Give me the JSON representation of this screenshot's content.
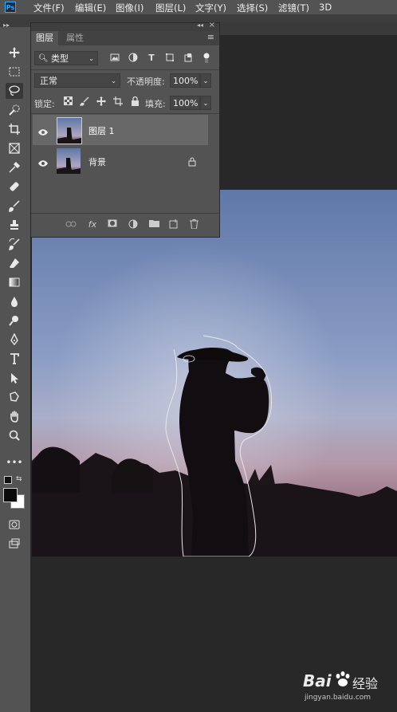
{
  "menubar": {
    "items": [
      "文件(F)",
      "编辑(E)",
      "图像(I)",
      "图层(L)",
      "文字(Y)",
      "选择(S)",
      "滤镜(T)",
      "3D"
    ]
  },
  "app": {
    "logo": "Ps"
  },
  "toolbar": {
    "collapse": "▸▸",
    "tools": [
      "move-tool",
      "marquee-tool",
      "lasso-tool",
      "quick-select-tool",
      "crop-tool",
      "frame-tool",
      "eyedropper-tool",
      "healing-tool",
      "brush-tool",
      "stamp-tool",
      "history-brush-tool",
      "eraser-tool",
      "gradient-tool",
      "blur-tool",
      "dodge-tool",
      "pen-tool",
      "type-tool",
      "path-select-tool",
      "shape-tool",
      "hand-tool",
      "zoom-tool",
      "more-tools"
    ]
  },
  "layers_panel": {
    "collapse": "◂◂",
    "close": "×",
    "menu": "≡",
    "tabs": [
      "图层",
      "属性"
    ],
    "filter_kind": "类型",
    "blend_mode": "正常",
    "opacity_label": "不透明度:",
    "opacity_value": "100%",
    "lock_label": "锁定:",
    "fill_label": "填充:",
    "fill_value": "100%",
    "layers": [
      {
        "name": "图层 1",
        "selected": true,
        "locked": false
      },
      {
        "name": "背景",
        "selected": false,
        "locked": true
      }
    ],
    "bottom_fx": "fx"
  },
  "colors": {
    "accent": "#31a8ff",
    "panel_bg": "#535353",
    "canvas_bg": "#282828",
    "selected_row": "#686868"
  },
  "watermark": {
    "brand": "Bai",
    "brand2": "经验",
    "domain": "jingyan.baidu.com"
  }
}
